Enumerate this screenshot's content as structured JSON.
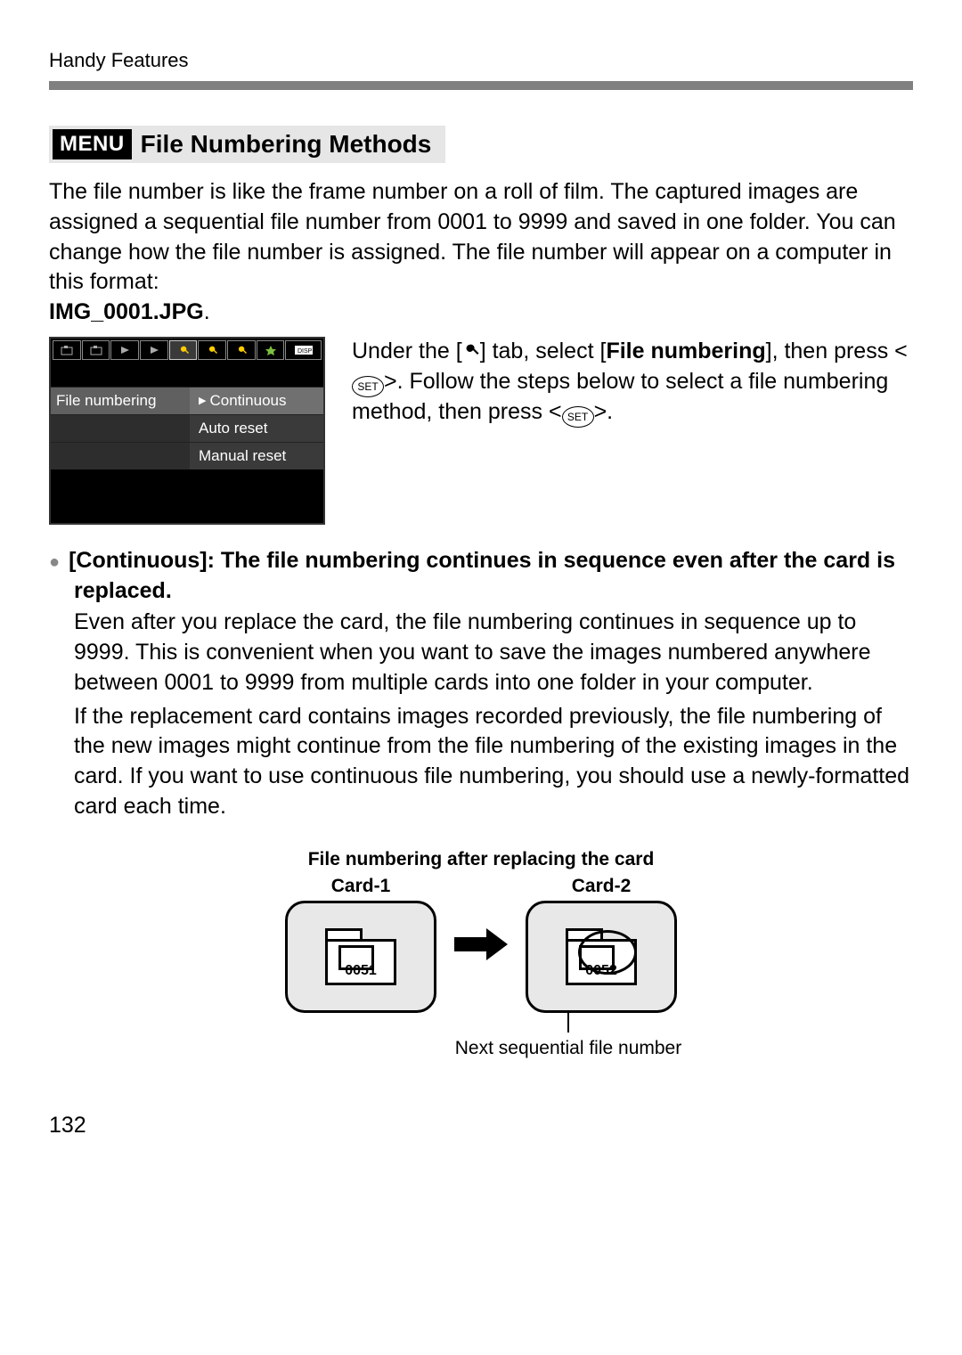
{
  "header": {
    "breadcrumb": "Handy Features"
  },
  "section": {
    "menu_badge": "MENU",
    "title": "File Numbering Methods"
  },
  "intro": {
    "text": "The file number is like the frame number on a roll of film. The captured images are assigned a sequential file number from 0001 to 9999 and saved in one folder. You can change how the file number is assigned. The file number will appear on a computer in this format:",
    "filename": "IMG_0001.JPG"
  },
  "cam_menu": {
    "row_label": "File numbering",
    "options": [
      "Continuous",
      "Auto reset",
      "Manual reset"
    ]
  },
  "instruction": {
    "pre": "Under the [",
    "mid1": "] tab, select [",
    "item": "File numbering",
    "mid2": "], then press <",
    "set": "SET",
    "mid3": ">. Follow the steps below to select a file numbering method, then press <",
    "end": ">."
  },
  "continuous": {
    "heading": "[Continuous]: The file numbering continues in sequence even after the card is replaced.",
    "p1": "Even after you replace the card, the file numbering continues in sequence up to 9999. This is convenient when you want to save the images numbered anywhere between 0001 to 9999 from multiple cards into one folder in your computer.",
    "p2": "If the replacement card contains images recorded previously, the file numbering of the new images might continue from the file numbering of the existing images in the card. If you want to use continuous file numbering, you should use a newly-formatted card each time."
  },
  "diagram": {
    "caption": "File numbering after replacing the card",
    "card1_label": "Card-1",
    "card1_num": "0051",
    "card2_label": "Card-2",
    "card2_num": "0052",
    "footer": "Next sequential file number"
  },
  "page_number": "132"
}
